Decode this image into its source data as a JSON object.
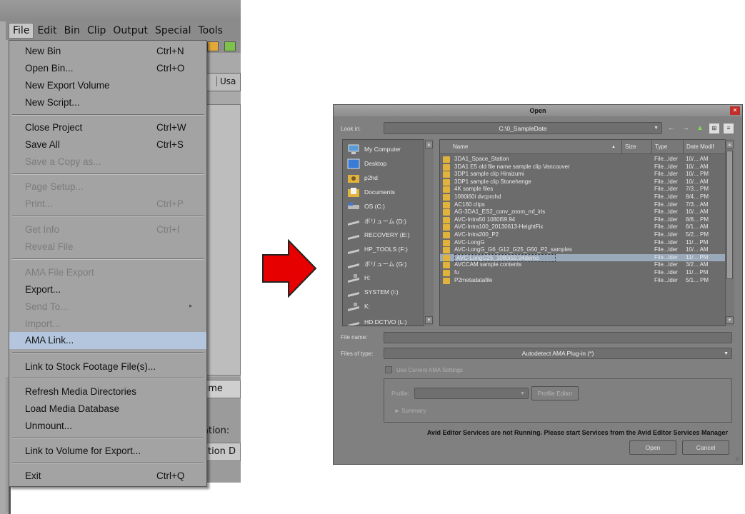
{
  "left": {
    "menubar": [
      "File",
      "Edit",
      "Bin",
      "Clip",
      "Output",
      "Special",
      "Tools"
    ],
    "menu_items": [
      {
        "label": "New Bin",
        "shortcut": "Ctrl+N",
        "enabled": true
      },
      {
        "label": "Open Bin...",
        "shortcut": "Ctrl+O",
        "enabled": true
      },
      {
        "label": "New Export Volume",
        "shortcut": "",
        "enabled": true
      },
      {
        "label": "New Script...",
        "shortcut": "",
        "enabled": true
      },
      {
        "label": "Close Project",
        "shortcut": "Ctrl+W",
        "enabled": true
      },
      {
        "label": "Save All",
        "shortcut": "Ctrl+S",
        "enabled": true
      },
      {
        "label": "Save a Copy as...",
        "shortcut": "",
        "enabled": false
      },
      {
        "label": "Page Setup...",
        "shortcut": "",
        "enabled": false
      },
      {
        "label": "Print...",
        "shortcut": "Ctrl+P",
        "enabled": false
      },
      {
        "label": "Get Info",
        "shortcut": "Ctrl+I",
        "enabled": false
      },
      {
        "label": "Reveal File",
        "shortcut": "",
        "enabled": false
      },
      {
        "label": "AMA File Export",
        "shortcut": "",
        "enabled": false
      },
      {
        "label": "Export...",
        "shortcut": "",
        "enabled": true
      },
      {
        "label": "Send To...",
        "shortcut": "",
        "enabled": false
      },
      {
        "label": "Import...",
        "shortcut": "",
        "enabled": false
      },
      {
        "label": "AMA Link...",
        "shortcut": "",
        "enabled": true
      },
      {
        "label": "Link to Stock Footage File(s)...",
        "shortcut": "",
        "enabled": true
      },
      {
        "label": "Refresh Media Directories",
        "shortcut": "",
        "enabled": true
      },
      {
        "label": "Load Media Database",
        "shortcut": "",
        "enabled": true
      },
      {
        "label": "Unmount...",
        "shortcut": "",
        "enabled": true
      },
      {
        "label": "Link to Volume for Export...",
        "shortcut": "",
        "enabled": true
      },
      {
        "label": "Exit",
        "shortcut": "Ctrl+Q",
        "enabled": true
      }
    ],
    "background": {
      "tab_a": "t",
      "tab_b": "Usa",
      "lower_bar_text": "ume",
      "lower_label": "ation:",
      "lower_bar2_text": "ation D"
    }
  },
  "dialog": {
    "title": "Open",
    "look_in_label": "Look in:",
    "look_in_value": "C:\\0_SampleDate",
    "places": [
      {
        "label": "My Computer",
        "icon": "computer-icon"
      },
      {
        "label": "Desktop",
        "icon": "desktop-icon"
      },
      {
        "label": "p2hd",
        "icon": "user-folder-icon"
      },
      {
        "label": "Documents",
        "icon": "documents-icon"
      },
      {
        "label": "OS (C:)",
        "icon": "drive-icon"
      },
      {
        "label": "ボリューム (D:)",
        "icon": "drive-icon"
      },
      {
        "label": "RECOVERY (E:)",
        "icon": "drive-icon"
      },
      {
        "label": "HP_TOOLS (F:)",
        "icon": "drive-icon"
      },
      {
        "label": "ボリューム (G:)",
        "icon": "drive-icon"
      },
      {
        "label": "H:",
        "icon": "removable-drive-icon"
      },
      {
        "label": "SYSTEM (I:)",
        "icon": "drive-icon"
      },
      {
        "label": "K:",
        "icon": "removable-drive-icon"
      },
      {
        "label": "HD DCTVO (L:)",
        "icon": "drive-icon"
      }
    ],
    "columns": {
      "name": "Name",
      "size": "Size",
      "type": "Type",
      "date": "Date Modif"
    },
    "files": [
      {
        "name": "3DA1_Space_Station",
        "type": "File...lder",
        "date": "10/... AM"
      },
      {
        "name": "3DA1 E5 old file name sample clip Vancouver",
        "type": "File...lder",
        "date": "10/... AM"
      },
      {
        "name": "3DP1 sample clip Hiraizumi",
        "type": "File...lder",
        "date": "10/... PM"
      },
      {
        "name": "3DP1 sample clip Stonehenge",
        "type": "File...lder",
        "date": "10/... AM"
      },
      {
        "name": "4K sample files",
        "type": "File...lder",
        "date": "7/3... PM"
      },
      {
        "name": "1080i60i dvcprohd",
        "type": "File...lder",
        "date": "8/4... PM"
      },
      {
        "name": "AC160 clips",
        "type": "File...lder",
        "date": "7/3... AM"
      },
      {
        "name": "AG-3DA1_ES2_conv_zoom_mf_iris",
        "type": "File...lder",
        "date": "10/... AM"
      },
      {
        "name": "AVC-Intra50 1080i59.94",
        "type": "File...lder",
        "date": "8/8... PM"
      },
      {
        "name": "AVC-Intra100_20130613-HeightFix",
        "type": "File...lder",
        "date": "6/1... AM"
      },
      {
        "name": "AVC-Intra200_P2",
        "type": "File...lder",
        "date": "5/2... PM"
      },
      {
        "name": "AVC-LongG",
        "type": "File...lder",
        "date": "11/... PM"
      },
      {
        "name": "AVC-LongG_G6_G12_G25_G50_P2_samples",
        "type": "File...lder",
        "date": "10/... AM"
      },
      {
        "name": "AVC-LongG25_1080i59.94demo",
        "type": "File...lder",
        "date": "11/... PM",
        "selected": true
      },
      {
        "name": "AVCCAM sample contents",
        "type": "File...lder",
        "date": "3/2... AM"
      },
      {
        "name": "fu",
        "type": "File...lder",
        "date": "11/... PM"
      },
      {
        "name": "P2metadatafile",
        "type": "File...lder",
        "date": "5/1... PM"
      }
    ],
    "file_name_label": "File name:",
    "file_name_value": "",
    "files_of_type_label": "Files of type:",
    "files_of_type_value": "Autodetect AMA Plug-in (*)",
    "use_ama_settings_label": "Use Current AMA Settings",
    "profile_label": "Profile:",
    "profile_value": "",
    "profile_editor_label": "Profile Editor",
    "summary_label": "Summary",
    "warning": "Avid Editor Services are not Running. Please start Services from the Avid Editor Services Manager",
    "open_label": "Open",
    "cancel_label": "Cancel"
  },
  "colors": {
    "arrow_fill": "#e60000",
    "menu_highlight": "#b3c6de",
    "folder_icon": "#e2b33b",
    "close_button": "#c02e2a"
  }
}
